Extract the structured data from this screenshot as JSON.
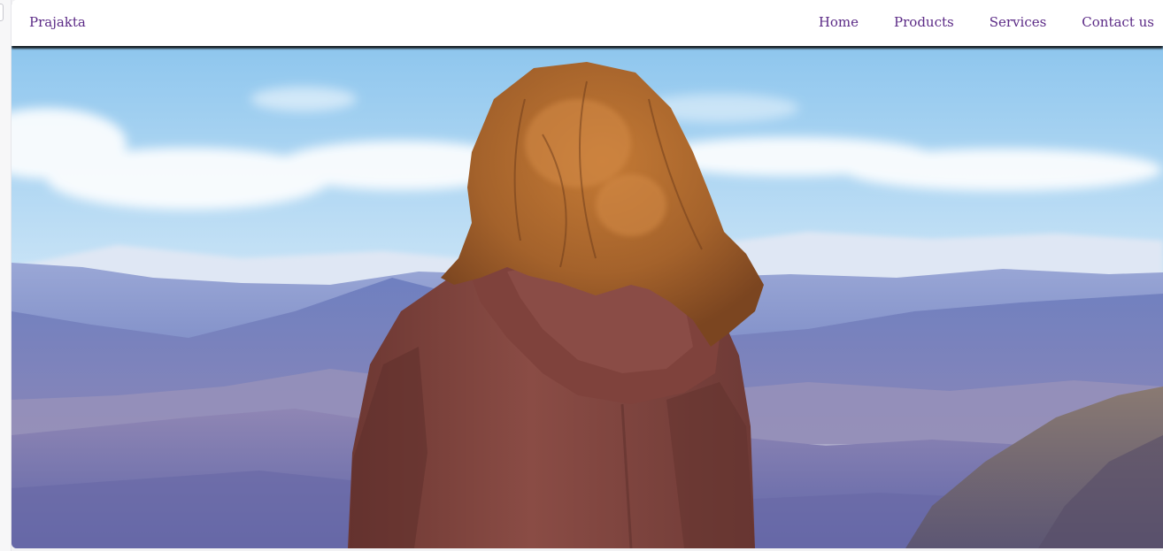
{
  "navbar": {
    "brand": "Prajakta",
    "links": [
      {
        "label": "Home"
      },
      {
        "label": "Products"
      },
      {
        "label": "Services"
      },
      {
        "label": "Contact us"
      }
    ]
  },
  "colors": {
    "nav_text": "#5b2a86",
    "sky": "#a9d3f0",
    "mountain": "#6f7fbf",
    "hoodie": "#7d4740",
    "hair": "#b06a2c"
  },
  "hero": {
    "icon": "hero-image"
  }
}
